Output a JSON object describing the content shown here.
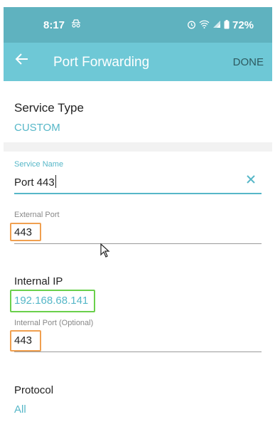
{
  "status_bar": {
    "time": "8:17",
    "battery": "72%",
    "icons": [
      "incognito-icon",
      "alarm-icon",
      "wifi-icon",
      "signal-icon",
      "battery-icon"
    ]
  },
  "app_bar": {
    "title": "Port Forwarding",
    "done_label": "DONE",
    "back_icon": "arrow-left-icon"
  },
  "service_type": {
    "label": "Service Type",
    "value": "CUSTOM"
  },
  "service_name": {
    "label": "Service Name",
    "value": "Port 443",
    "clear_icon": "close-icon"
  },
  "external_port": {
    "label": "External Port",
    "value": "443"
  },
  "internal_ip": {
    "label": "Internal IP",
    "value": "192.168.68.141"
  },
  "internal_port": {
    "label": "Internal Port (Optional)",
    "value": "443"
  },
  "protocol": {
    "label": "Protocol",
    "value": "All"
  },
  "colors": {
    "status_bar": "#5fb2bf",
    "app_bar": "#6ec8d6",
    "accent": "#56b7c8",
    "highlight_orange": "#f0a050",
    "highlight_green": "#6ad04b"
  }
}
